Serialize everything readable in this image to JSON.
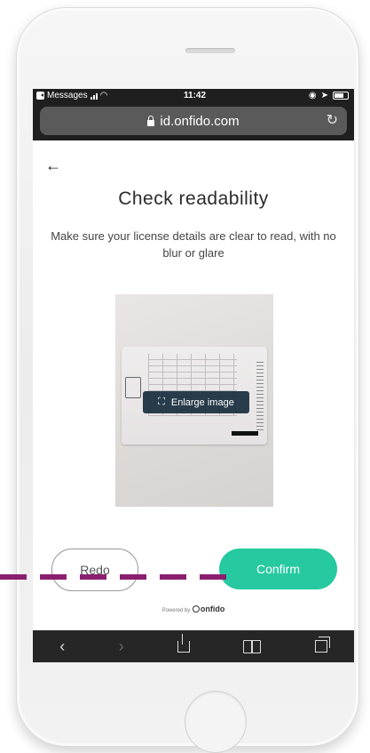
{
  "status_bar": {
    "back_app": "Messages",
    "time": "11:42"
  },
  "browser": {
    "url": "id.onfido.com"
  },
  "page": {
    "title": "Check readability",
    "subtitle": "Make sure your license details are clear to read, with no blur or glare",
    "enlarge_label": "Enlarge image",
    "redo_label": "Redo",
    "confirm_label": "Confirm",
    "powered_by_prefix": "Powered by",
    "powered_by_brand": "onfido"
  },
  "colors": {
    "accent": "#27c9a0",
    "annotation": "#8b1f6f",
    "browser_chrome": "#1f1f1f"
  },
  "icons": [
    "back-arrow-icon",
    "lock-icon",
    "reload-icon",
    "expand-icon",
    "share-icon",
    "bookmarks-icon",
    "tabs-icon"
  ]
}
